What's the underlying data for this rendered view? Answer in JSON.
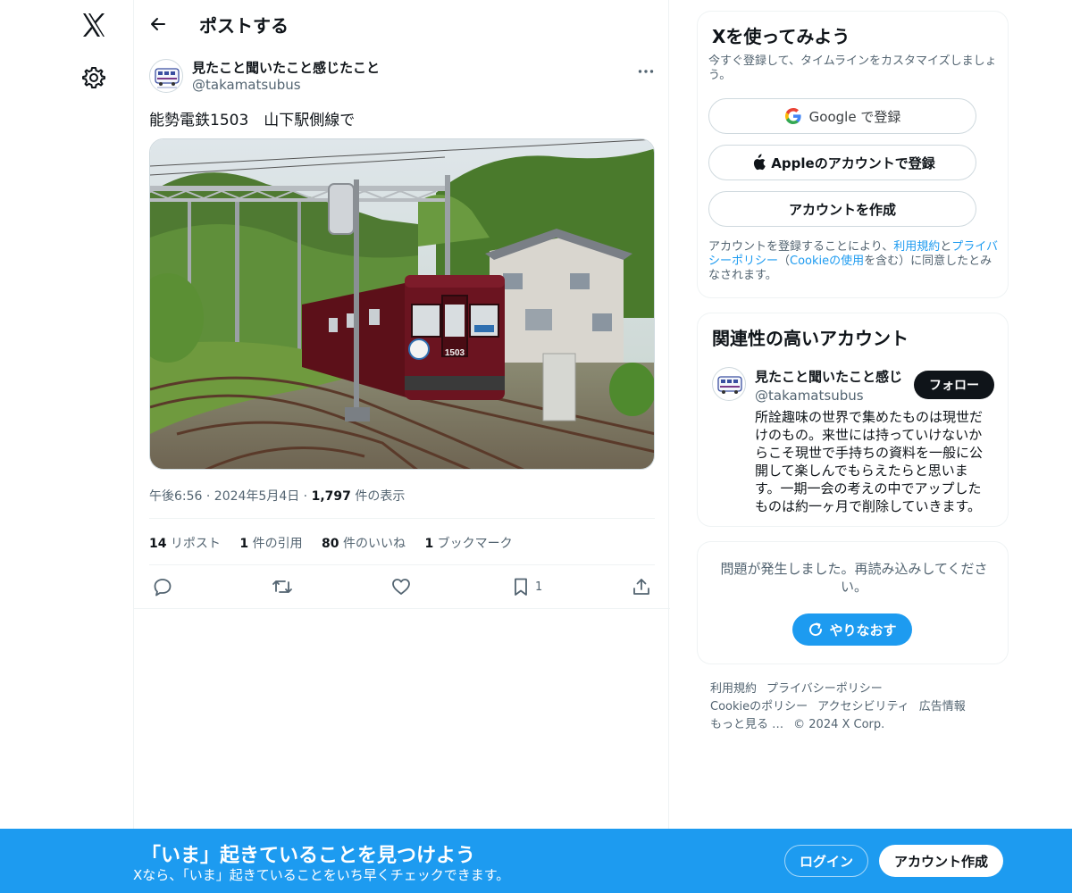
{
  "nav": {
    "logo_icon": "x-logo-icon",
    "settings_icon": "gear-icon"
  },
  "header": {
    "title": "ポストする",
    "back_icon": "back-arrow-icon"
  },
  "post": {
    "author_name": "見たこと聞いたこと感じたこと",
    "author_handle": "@takamatsubus",
    "text": "能勢電鉄1503　山下駅側線で",
    "timestamp": "午後6:56 · 2024年5月4日 · ",
    "views_count": "1,797",
    "views_label": " 件の表示",
    "stats": [
      {
        "count": "14",
        "label": " リポスト"
      },
      {
        "count": "1",
        "label": " 件の引用"
      },
      {
        "count": "80",
        "label": " 件のいいね"
      },
      {
        "count": "1",
        "label": " ブックマーク"
      }
    ],
    "bookmark_count": "1",
    "train_number": "1503"
  },
  "signup_card": {
    "title": "Xを使ってみよう",
    "subtitle": "今すぐ登録して、タイムラインをカスタマイズしましょう。",
    "google_label": "Google で登録",
    "apple_label": "Appleのアカウントで登録",
    "create_label": "アカウントを作成",
    "legal_1": "アカウントを登録することにより、",
    "terms_link": "利用規約",
    "legal_2": "と",
    "privacy_link": "プライバシーポリシー",
    "legal_3": "（",
    "cookie_link": "Cookieの使用",
    "legal_4": "を含む）に同意したとみなされます。"
  },
  "related_card": {
    "title": "関連性の高いアカウント",
    "name": "見たこと聞いたこと感じ",
    "handle": "@takamatsubus",
    "follow_label": "フォロー",
    "bio": "所詮趣味の世界で集めたものは現世だけのもの。来世には持っていけないからこそ現世で手持ちの資料を一般に公開して楽しんでもらえたらと思います。一期一会の考えの中でアップしたものは約一ヶ月で削除していきます。"
  },
  "error_card": {
    "message": "問題が発生しました。再読み込みしてください。",
    "retry_label": "やりなおす"
  },
  "footer": {
    "terms": "利用規約",
    "privacy": "プライバシーポリシー",
    "cookie": "Cookieのポリシー",
    "accessibility": "アクセシビリティ",
    "ads": "広告情報",
    "more": "もっと見る …",
    "copyright": "© 2024 X Corp."
  },
  "bottom_bar": {
    "title": "「いま」起きていることを見つけよう",
    "subtitle": "Xなら、「いま」起きていることをいち早くチェックできます。",
    "login_label": "ログイン",
    "signup_label": "アカウント作成"
  },
  "colors": {
    "accent": "#1d9bf0",
    "text": "#0f1419",
    "muted": "#536471",
    "train_maroon": "#6b1420"
  }
}
